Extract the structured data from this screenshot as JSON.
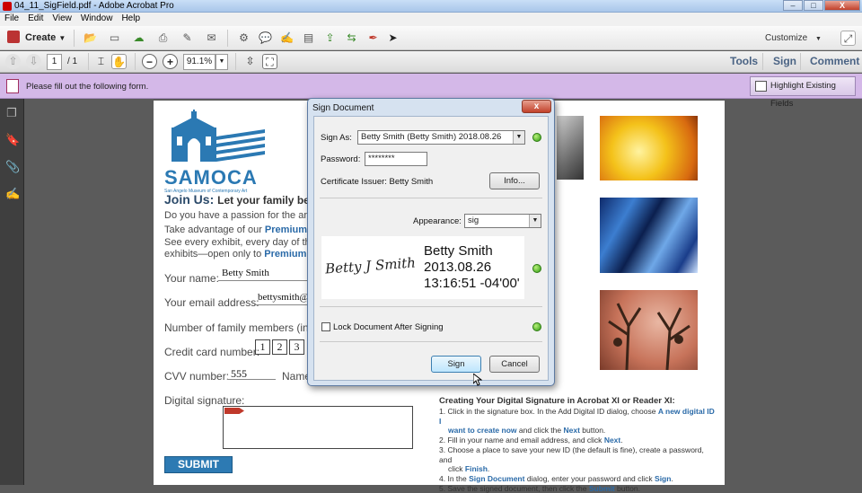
{
  "window": {
    "title": "04_11_SigField.pdf - Adobe Acrobat Pro",
    "min_label": "–",
    "max_label": "□",
    "close_label": "X"
  },
  "menu": [
    "File",
    "Edit",
    "View",
    "Window",
    "Help"
  ],
  "toolbar": {
    "create_label": "Create",
    "customize_label": "Customize",
    "page_current": "1",
    "page_total": "/ 1",
    "zoom": "91.1%",
    "panes": [
      "Tools",
      "Sign",
      "Comment"
    ]
  },
  "formbar": {
    "message": "Please fill out the following form.",
    "highlight_label": "Highlight Existing Fields"
  },
  "document": {
    "logo_text": "SAMOCA",
    "logo_subtitle": "San Angelo Museum of Contemporary Art",
    "join_heading": "Join Us:",
    "join_sub": "Let your family bec",
    "line1": "Do you have a passion for the arts?",
    "line2a": "Take advantage of our ",
    "line2b": "Premium Fa",
    "line3": "See every exhibit, every day of the ye",
    "line4a": "exhibits—open only to ",
    "line4b": "Premium F",
    "name_label": "Your name:",
    "name_value": "Betty Smith",
    "email_label": "Your email address:",
    "email_value": "bettysmith@sa",
    "members_label": "Number of family members (inc",
    "cc_label": "Credit card number:",
    "cc_digits": [
      "1",
      "2",
      "3"
    ],
    "cvv_label": "CVV number:",
    "cvv_value": "555",
    "name2_label": "Name",
    "sig_label": "Digital signature:",
    "submit_label": "SUBMIT",
    "help_title": "Creating Your Digital Signature in Acrobat XI or Reader XI:",
    "help_steps": [
      {
        "num": "1.",
        "a": "Click in the signature box. In the Add Digital ID dialog, choose ",
        "b": "A new digital ID I",
        "c": ""
      },
      {
        "num": "",
        "a": "",
        "b": "want to create now",
        "c": " and click the "
      },
      {
        "num": "",
        "a": "",
        "b": "Next",
        "c": " button."
      },
      {
        "num": "2.",
        "a": "Fill in your name and email address, and click ",
        "b": "Next",
        "c": "."
      },
      {
        "num": "3.",
        "a": "Choose a place to save your new ID (the default is fine), create a password, and",
        "b": "",
        "c": ""
      },
      {
        "num": "",
        "a": "click ",
        "b": "Finish",
        "c": "."
      },
      {
        "num": "4.",
        "a": "In the ",
        "b": "Sign Document",
        "c": " dialog, enter your password and click "
      },
      {
        "num": "",
        "a": "",
        "b": "Sign",
        "c": "."
      },
      {
        "num": "5.",
        "a": "Save the signed document, then click the ",
        "b": "Submit",
        "c": " button."
      }
    ]
  },
  "dialog": {
    "title": "Sign Document",
    "close_label": "x",
    "sign_as_label": "Sign As:",
    "sign_as_value": "Betty Smith (Betty Smith) 2018.08.26",
    "password_label": "Password:",
    "password_value": "********",
    "issuer_text": "Certificate Issuer: Betty Smith",
    "info_label": "Info...",
    "appearance_label": "Appearance:",
    "appearance_value": "sig",
    "sig_script": "Betty J Smith",
    "sig_name": "Betty Smith",
    "sig_date": "2013.08.26",
    "sig_time": "13:16:51 -04'00'",
    "lock_label": "Lock Document After Signing",
    "sign_button": "Sign",
    "cancel_button": "Cancel"
  },
  "colors": {
    "form_bar": "#d4b8e8",
    "link_blue": "#2a6aa8",
    "submit_bg": "#2d7ab3",
    "logo_blue": "#2b79b3"
  }
}
